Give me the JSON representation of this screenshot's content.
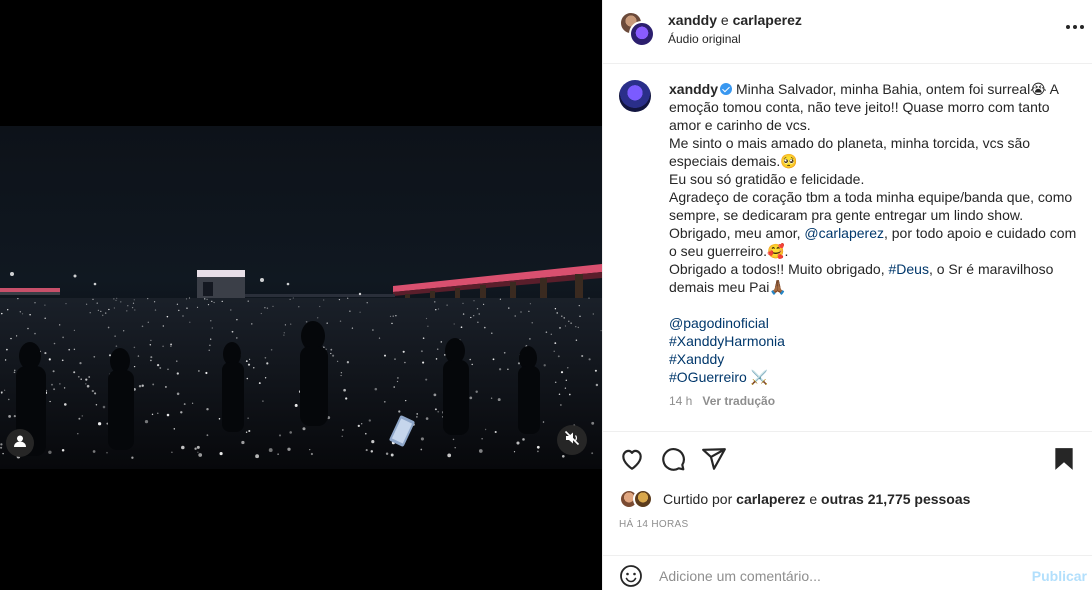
{
  "header": {
    "user1": "xanddy",
    "separator": "e",
    "user2": "carlaperez",
    "audio": "Áudio original"
  },
  "caption": {
    "username": "xanddy",
    "lines": [
      "Minha Salvador, minha Bahia, ontem foi surreal😭 A emoção tomou conta, não teve jeito!! Quase morro com tanto amor e carinho de vcs.",
      "Me sinto o mais amado do planeta, minha torcida, vcs são especiais demais.🥺",
      "Eu sou só gratidão e felicidade.",
      "Agradeço de coração tbm a toda minha equipe/banda que, como sempre, se dedicaram pra gente entregar um lindo show."
    ],
    "thanks_prefix": "Obrigado, meu amor, ",
    "thanks_mention": "@carlaperez",
    "thanks_suffix": ", por todo apoio e cuidado com o seu guerreiro.🥰.",
    "final_prefix": "Obrigado a todos!! Muito obrigado, ",
    "final_tag": "#Deus",
    "final_suffix": ", o Sr é maravilhoso demais meu Pai🙏🏾",
    "tags": [
      "@pagodinoficial",
      "#XanddyHarmonia",
      "#Xanddy",
      "#OGuerreiro ⚔️"
    ],
    "time": "14 h",
    "translate": "Ver tradução"
  },
  "likes": {
    "prefix": "Curtido por",
    "user": "carlaperez",
    "middle": "e",
    "others": "outras 21,775 pessoas"
  },
  "posted_ago": "HÁ 14 HORAS",
  "comment": {
    "placeholder": "Adicione um comentário...",
    "publish": "Publicar"
  },
  "icons": {
    "more": "more-options-icon",
    "like": "heart-icon",
    "comment": "comment-icon",
    "share": "share-icon",
    "save": "bookmark-icon",
    "tag": "user-tag-icon",
    "mute": "muted-speaker-icon",
    "emoji": "emoji-icon"
  },
  "colors": {
    "link": "#00376b",
    "verified": "#3897f0",
    "publish": "#b2dffc",
    "muted": "#8e8e8e"
  }
}
